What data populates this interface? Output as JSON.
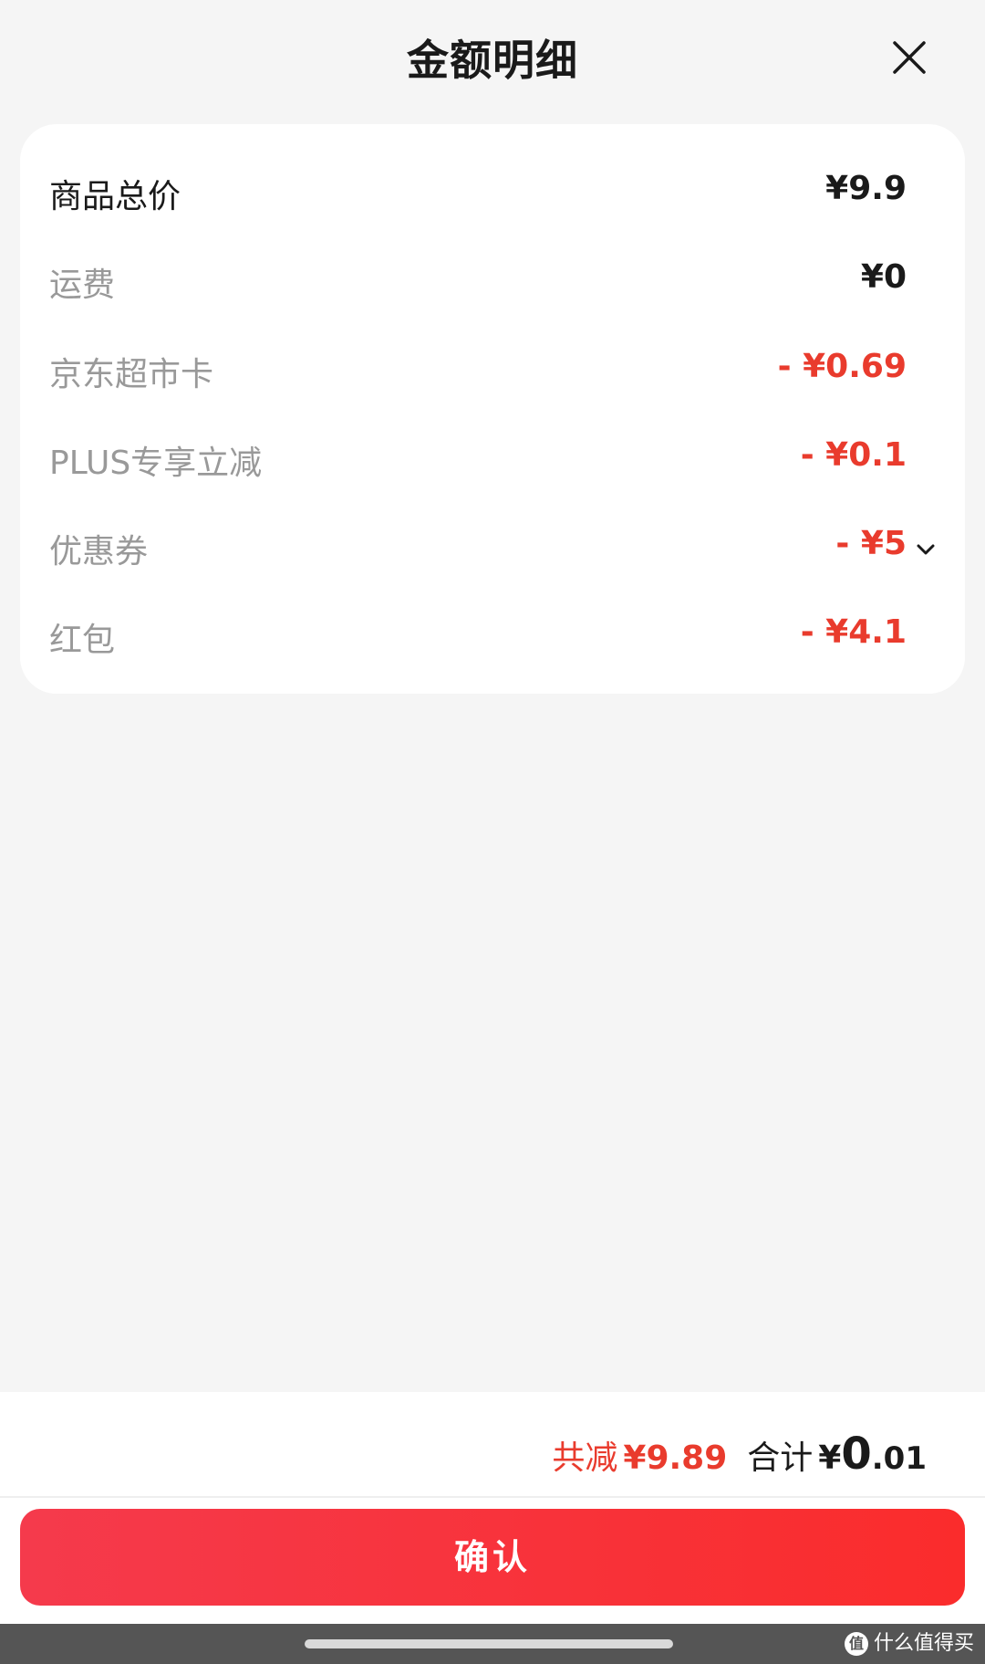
{
  "header": {
    "title": "金额明细",
    "close_icon": "close-icon"
  },
  "rows": [
    {
      "label": "商品总价",
      "value": "¥9.9",
      "value_color": "#1a1a1a",
      "label_color": "#1a1a1a"
    },
    {
      "label": "运费",
      "value": "¥0",
      "value_color": "#1a1a1a",
      "label_color": "#999999"
    },
    {
      "label": "京东超市卡",
      "value": "- ¥0.69",
      "value_color": "#e93b2d",
      "label_color": "#999999"
    },
    {
      "label": "PLUS专享立减",
      "value": "- ¥0.1",
      "value_color": "#e93b2d",
      "label_color": "#999999"
    },
    {
      "label": "优惠券",
      "value": "- ¥5",
      "value_color": "#e93b2d",
      "label_color": "#999999",
      "icon": "chevron-down-icon"
    },
    {
      "label": "红包",
      "value": "- ¥4.1",
      "value_color": "#e93b2d",
      "label_color": "#999999"
    }
  ],
  "summary": {
    "discount_label": "共减",
    "discount_value": "¥9.89",
    "total_label": "合计",
    "total_currency": "¥",
    "total_int": "0",
    "total_dec": ".01"
  },
  "confirm_button": {
    "label": "确认"
  },
  "watermark": {
    "icon_char": "值",
    "text": "什么值得买"
  },
  "colors": {
    "accent": "#e93b2d",
    "button_gradient_start": "#f53a4c",
    "button_gradient_end": "#fa2c2c",
    "background": "#f5f5f5",
    "card": "#ffffff"
  }
}
